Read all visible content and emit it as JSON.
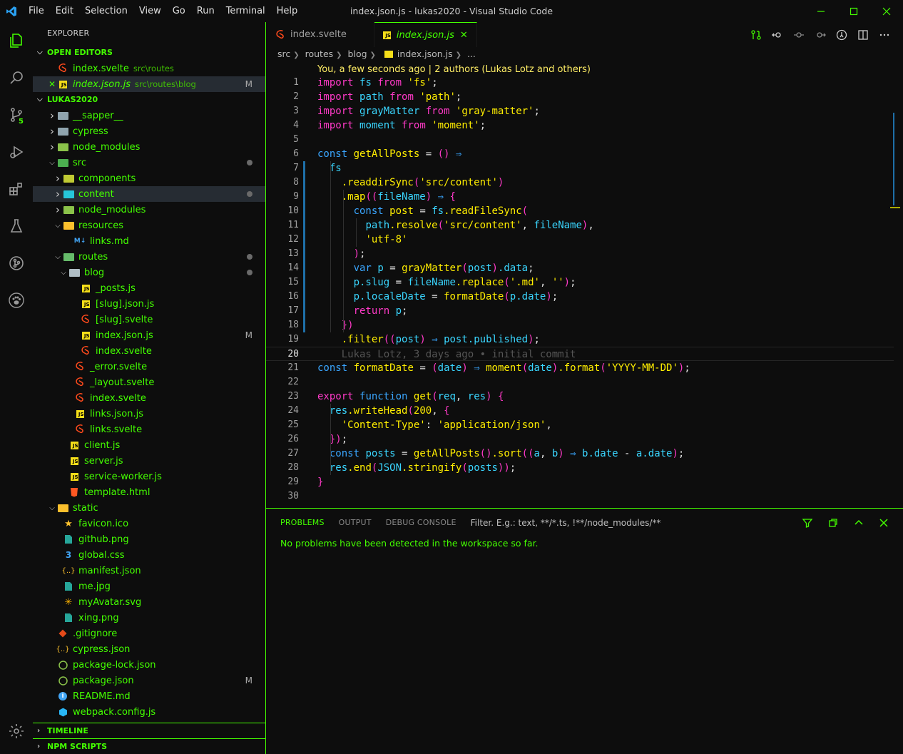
{
  "window": {
    "title": "index.json.js - lukas2020 - Visual Studio Code",
    "menu": [
      "File",
      "Edit",
      "Selection",
      "View",
      "Go",
      "Run",
      "Terminal",
      "Help"
    ]
  },
  "activity": {
    "scm_badge": "5"
  },
  "sidebar": {
    "title": "EXPLORER",
    "open_editors_label": "OPEN EDITORS",
    "open_editors": [
      {
        "name": "index.svelte",
        "desc": "src\\routes"
      },
      {
        "name": "index.json.js",
        "desc": "src\\routes\\blog",
        "mark": "M"
      }
    ],
    "project_label": "LUKAS2020",
    "tree": [
      {
        "name": "__sapper__"
      },
      {
        "name": "cypress"
      },
      {
        "name": "node_modules"
      },
      {
        "name": "src"
      },
      {
        "name": "components"
      },
      {
        "name": "content"
      },
      {
        "name": "node_modules"
      },
      {
        "name": "resources"
      },
      {
        "name": "links.md"
      },
      {
        "name": "routes"
      },
      {
        "name": "blog"
      },
      {
        "name": "_posts.js"
      },
      {
        "name": "[slug].json.js"
      },
      {
        "name": "[slug].svelte"
      },
      {
        "name": "index.json.js",
        "mark": "M"
      },
      {
        "name": "index.svelte"
      },
      {
        "name": "_error.svelte"
      },
      {
        "name": "_layout.svelte"
      },
      {
        "name": "index.svelte"
      },
      {
        "name": "links.json.js"
      },
      {
        "name": "links.svelte"
      },
      {
        "name": "client.js"
      },
      {
        "name": "server.js"
      },
      {
        "name": "service-worker.js"
      },
      {
        "name": "template.html"
      },
      {
        "name": "static"
      },
      {
        "name": "favicon.ico"
      },
      {
        "name": "github.png"
      },
      {
        "name": "global.css"
      },
      {
        "name": "manifest.json"
      },
      {
        "name": "me.jpg"
      },
      {
        "name": "myAvatar.svg"
      },
      {
        "name": "xing.png"
      },
      {
        "name": ".gitignore"
      },
      {
        "name": "cypress.json"
      },
      {
        "name": "package-lock.json"
      },
      {
        "name": "package.json",
        "mark": "M"
      },
      {
        "name": "README.md"
      },
      {
        "name": "webpack.config.js"
      }
    ],
    "timeline_label": "TIMELINE",
    "npm_label": "NPM SCRIPTS"
  },
  "editor": {
    "tabs": [
      {
        "label": "index.svelte"
      },
      {
        "label": "index.json.js",
        "close": "✕"
      }
    ],
    "breadcrumb": [
      "src",
      "routes",
      "blog",
      "index.json.js",
      "..."
    ],
    "blame_header": "You, a few seconds ago | 2 authors (Lukas Lotz and others)",
    "line_numbers": [
      "1",
      "2",
      "3",
      "4",
      "5",
      "6",
      "7",
      "8",
      "9",
      "10",
      "11",
      "12",
      "13",
      "14",
      "15",
      "16",
      "17",
      "18",
      "19",
      "20",
      "21",
      "22",
      "23",
      "24",
      "25",
      "26",
      "27",
      "28",
      "29",
      "30"
    ],
    "blame_line20": "Lukas Lotz, 3 days ago • initial commit"
  },
  "panel": {
    "tabs": [
      "PROBLEMS",
      "OUTPUT",
      "DEBUG CONSOLE"
    ],
    "filter_placeholder": "Filter. E.g.: text, **/*.ts, !**/node_modules/**",
    "message": "No problems have been detected in the workspace so far."
  },
  "colors": {
    "accent": "#44ff00",
    "keyword": "#ff3ac8",
    "string": "#ffee00",
    "blue": "#3aa6ff",
    "cyan": "#3ad6ff"
  }
}
